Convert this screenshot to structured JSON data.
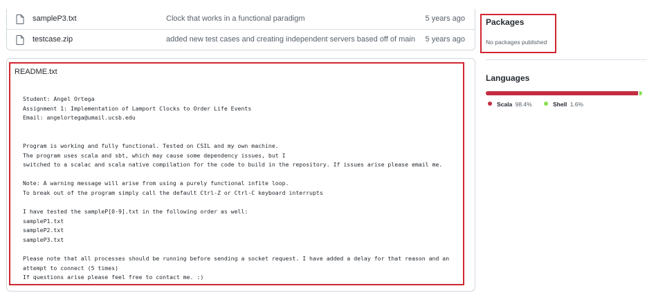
{
  "files": [
    {
      "name": "sampleP3.txt",
      "message": "Clock that works in a functional paradigm",
      "age": "5 years ago"
    },
    {
      "name": "testcase.zip",
      "message": "added new test cases and creating independent servers based off of main",
      "age": "5 years ago"
    }
  ],
  "readme": {
    "title": "README.txt",
    "lines": [
      "Student: Angel Ortega",
      "Assignment 1: Implementation of Lamport Clocks to Order Life Events",
      "Email: angelortega@umail.ucsb.edu",
      "",
      "",
      "Program is working and fully functional. Tested on CSIL and my own machine.",
      "The program uses scala and sbt, which may cause some dependency issues, but I",
      "switched to a scalac and scala native compilation for the code to build in the repository. If issues arise please email me.",
      "",
      "Note: A warning message will arise from using a purely functional infite loop.",
      "To break out of the program simply call the default Ctrl-Z or Ctrl-C keyboard interrupts",
      "",
      "I have tested the sampleP[0-9].txt in the following order as well:",
      "sampleP1.txt",
      "sampleP2.txt",
      "sampleP3.txt",
      "",
      "Please note that all processes should be running before sending a socket request. I have added a delay for that reason and an",
      "attempt to connect (5 times)",
      "If questions arise please feel free to contact me. :)"
    ]
  },
  "packages": {
    "title": "Packages",
    "empty_text": "No packages published"
  },
  "languages": {
    "title": "Languages",
    "items": [
      {
        "name": "Scala",
        "percent": "98.4%",
        "value": 98.4,
        "color": "#c22d40"
      },
      {
        "name": "Shell",
        "percent": "1.6%",
        "value": 1.6,
        "color": "#89e051"
      }
    ]
  }
}
